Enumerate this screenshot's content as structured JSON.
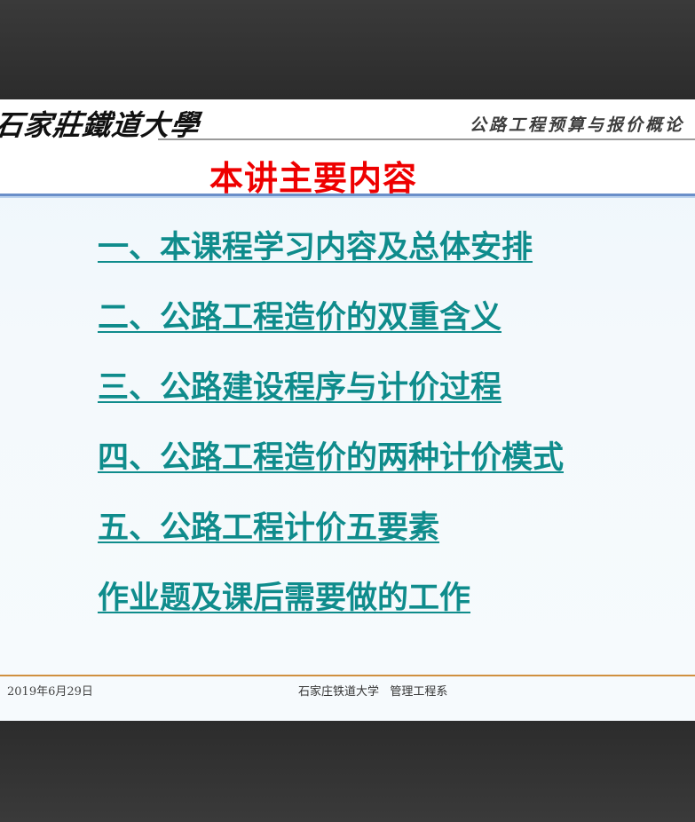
{
  "slide": {
    "logo_text": "石家莊鐵道大學",
    "course_title": "公路工程预算与报价概论",
    "title": "本讲主要内容",
    "toc_items": [
      "一、本课程学习内容及总体安排",
      "二、公路工程造价的双重含义",
      "三、公路建设程序与计价过程",
      "四、公路工程造价的两种计价模式",
      "五、公路工程计价五要素",
      "作业题及课后需要做的工作"
    ],
    "footer": {
      "date": "2019年6月29日",
      "organization": "石家庄铁道大学   管理工程系"
    }
  },
  "colors": {
    "title": "#ee0000",
    "link": "#0f8c8c",
    "footer_rule": "#d09040",
    "title_rule": "#6a8fc9"
  }
}
